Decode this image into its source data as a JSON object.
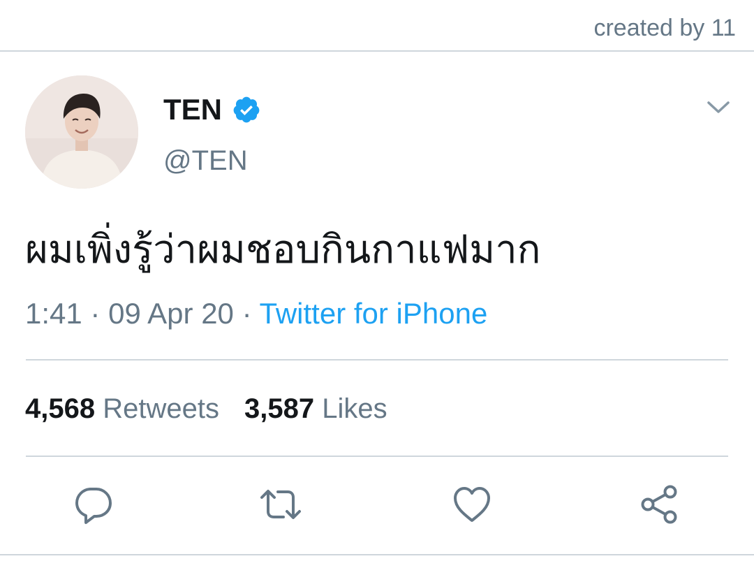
{
  "watermark": {
    "text": "created by 11"
  },
  "author": {
    "display_name": "TEN",
    "handle": "@TEN",
    "verified": true,
    "avatar_icon": "profile-photo"
  },
  "tweet": {
    "text": "ผมเพิ่งรู้ว่าผมชอบกินกาแฟมาก",
    "time": "1:41",
    "separator": "·",
    "date": "09 Apr 20",
    "source": "Twitter for iPhone"
  },
  "stats": {
    "retweets_count": "4,568",
    "retweets_label": "Retweets",
    "likes_count": "3,587",
    "likes_label": "Likes"
  },
  "actions": [
    {
      "name": "reply",
      "icon": "reply-icon"
    },
    {
      "name": "retweet",
      "icon": "retweet-icon"
    },
    {
      "name": "like",
      "icon": "heart-icon"
    },
    {
      "name": "share",
      "icon": "share-icon"
    }
  ],
  "colors": {
    "text_primary": "#14171a",
    "text_secondary": "#657786",
    "link_blue": "#1da1f2",
    "divider": "#cfd6dc",
    "verified_blue": "#1da1f2"
  }
}
